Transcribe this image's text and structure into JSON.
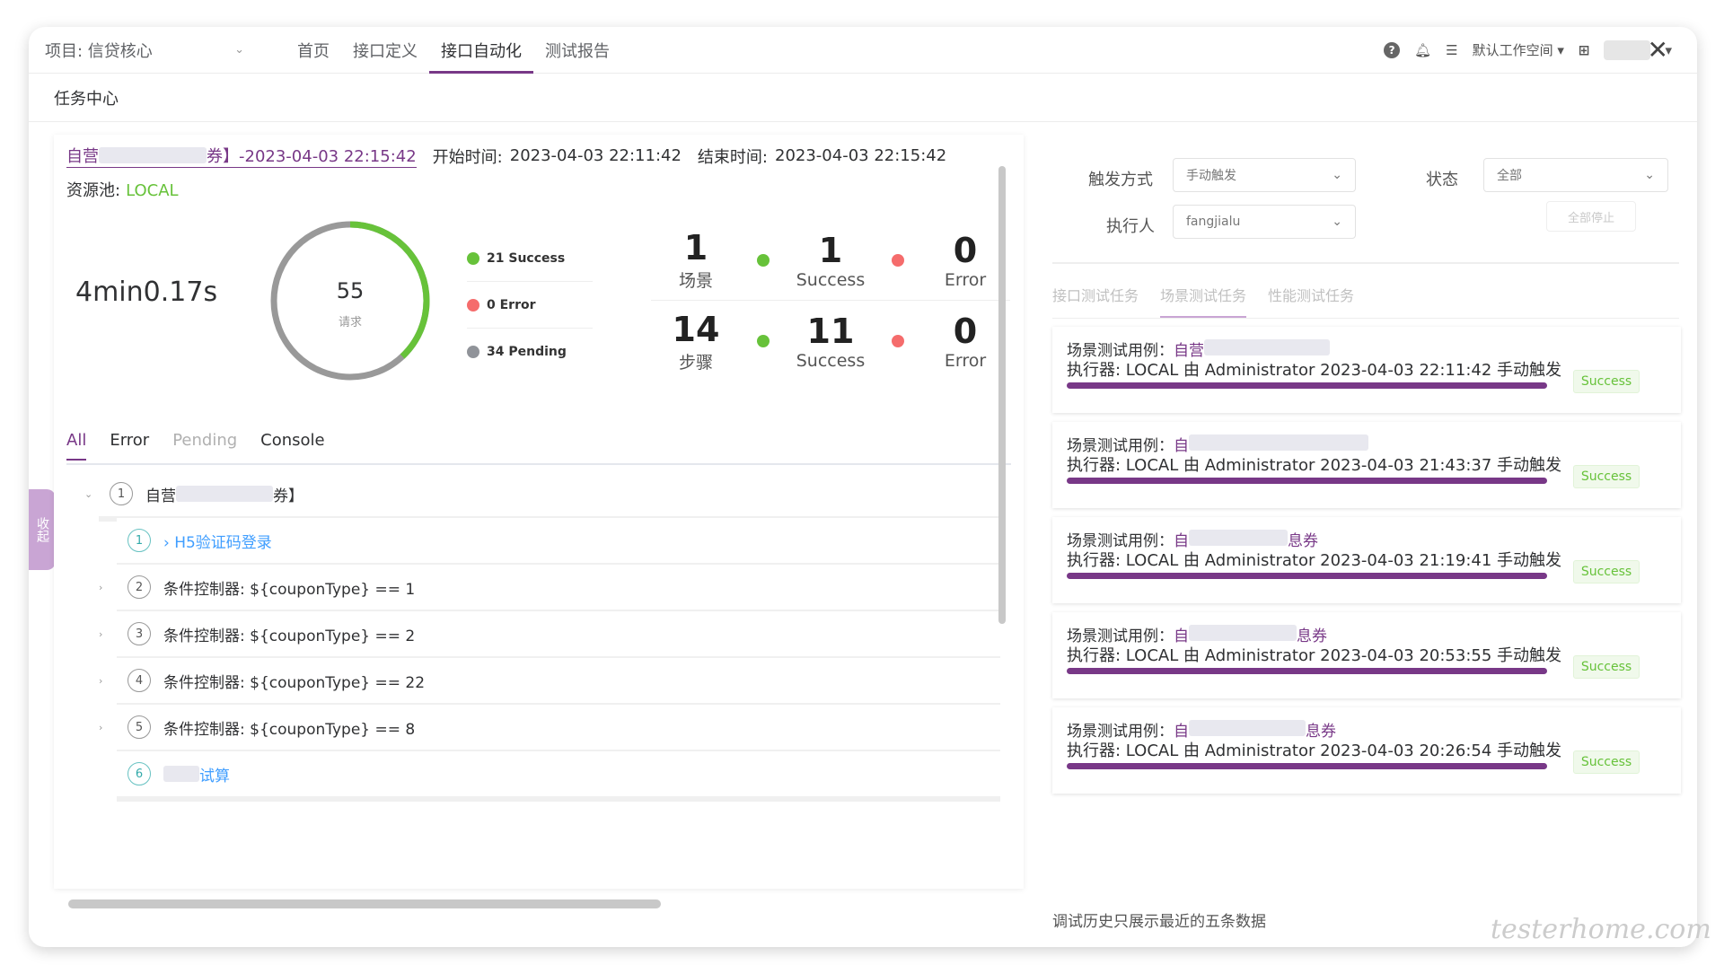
{
  "topbar": {
    "project": "项目: 信贷核心",
    "nav": [
      {
        "label": "首页",
        "active": false
      },
      {
        "label": "接口定义",
        "active": false
      },
      {
        "label": "接口自动化",
        "active": true
      },
      {
        "label": "测试报告",
        "active": false
      }
    ],
    "workspace": "默认工作空间"
  },
  "subheader": {
    "title": "任务中心"
  },
  "sidetab": {
    "label": "收起"
  },
  "report": {
    "name_prefix": "自营",
    "name_suffix": "券】-2023-04-03 22:15:42",
    "start_label": "开始时间:",
    "start_value": "2023-04-03 22:11:42",
    "end_label": "结束时间:",
    "end_value": "2023-04-03 22:15:42",
    "pool_label": "资源池:",
    "pool_value": "LOCAL",
    "duration": "4min0.17s",
    "requests": {
      "total": "55",
      "label": "请求",
      "success_fraction": 0.38
    },
    "legend": [
      {
        "text": "21 Success",
        "color": "#67c23a"
      },
      {
        "text": "0 Error",
        "color": "#f56c6c"
      },
      {
        "text": "34 Pending",
        "color": "#909399"
      }
    ],
    "scenario": {
      "total": "1",
      "total_label": "场景",
      "success": "1",
      "success_label": "Success",
      "error": "0",
      "error_label": "Error"
    },
    "step": {
      "total": "14",
      "total_label": "步骤",
      "success": "11",
      "success_label": "Success",
      "error": "0",
      "error_label": "Error"
    }
  },
  "tabs": [
    {
      "label": "All",
      "state": "active"
    },
    {
      "label": "Error",
      "state": "normal"
    },
    {
      "label": "Pending",
      "state": "dim"
    },
    {
      "label": "Console",
      "state": "normal"
    }
  ],
  "tree": {
    "root": {
      "index": "1",
      "prefix": "自营",
      "suffix": "券】"
    },
    "children": [
      {
        "index": "1",
        "text": "› H5验证码登录",
        "style": "link"
      },
      {
        "index": "2",
        "text": "条件控制器: ${couponType} == 1",
        "style": "normal"
      },
      {
        "index": "3",
        "text": "条件控制器: ${couponType} == 2",
        "style": "normal"
      },
      {
        "index": "4",
        "text": "条件控制器: ${couponType} == 22",
        "style": "normal"
      },
      {
        "index": "5",
        "text": "条件控制器: ${couponType} == 8",
        "style": "normal"
      },
      {
        "index": "6",
        "text": "试算",
        "style": "link"
      }
    ]
  },
  "filters": {
    "trigger_label": "触发方式",
    "trigger_value": "手动触发",
    "status_label": "状态",
    "status_value": "全部",
    "executor_label": "执行人",
    "executor_value": "fangjialu",
    "stop_all": "全部停止"
  },
  "right_tabs": [
    {
      "label": "接口测试任务",
      "active": false
    },
    {
      "label": "场景测试任务",
      "active": true
    },
    {
      "label": "性能测试任务",
      "active": false
    }
  ],
  "tasks": [
    {
      "case_label": "场景测试用例：",
      "case_prefix": "自营",
      "case_suffix": "",
      "executor": "执行器:  LOCAL 由 Administrator 2023-04-03 22:11:42 手动触发",
      "status": "Success"
    },
    {
      "case_label": "场景测试用例：",
      "case_prefix": "自",
      "case_suffix": "",
      "executor": "执行器:  LOCAL 由 Administrator 2023-04-03 21:43:37 手动触发",
      "status": "Success"
    },
    {
      "case_label": "场景测试用例：",
      "case_prefix": "自",
      "case_suffix": "息券",
      "executor": "执行器:  LOCAL 由 Administrator 2023-04-03 21:19:41 手动触发",
      "status": "Success"
    },
    {
      "case_label": "场景测试用例：",
      "case_prefix": "自",
      "case_suffix": "息券",
      "executor": "执行器:  LOCAL 由 Administrator 2023-04-03 20:53:55 手动触发",
      "status": "Success"
    },
    {
      "case_label": "场景测试用例：",
      "case_prefix": "自",
      "case_suffix": "息券",
      "executor": "执行器:  LOCAL 由 Administrator 2023-04-03 20:26:54 手动触发",
      "status": "Success"
    }
  ],
  "footnote": "调试历史只展示最近的五条数据",
  "watermark": "testerhome.com",
  "colors": {
    "brand": "#783887",
    "success": "#67c23a",
    "error": "#f56c6c",
    "pending": "#909399"
  }
}
